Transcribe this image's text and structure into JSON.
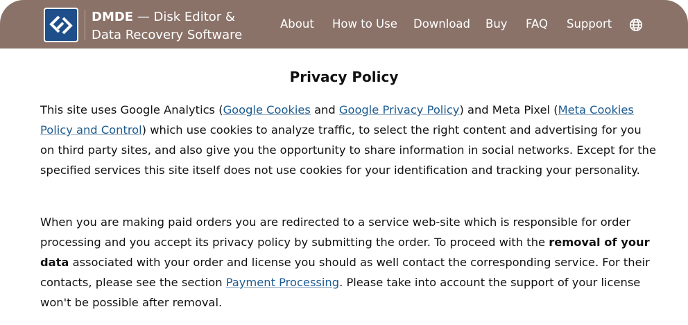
{
  "header": {
    "brand_name": "DMDE",
    "brand_line1_rest": " — Disk Editor &",
    "brand_line2": "Data Recovery Software",
    "nav": [
      "About",
      "How to Use",
      "Download",
      "Buy",
      "FAQ",
      "Support"
    ],
    "language_icon": "globe-icon",
    "logo_icon": "dmde-logo-icon",
    "colors": {
      "header_bg": "#8a7268",
      "logo_bg": "#1e4f8a",
      "link": "#1c5a8f"
    }
  },
  "page": {
    "title": "Privacy Policy",
    "p1": {
      "t1": "This site uses Google Analytics (",
      "link1": "Google Cookies",
      "t2": " and ",
      "link2": "Google Privacy Policy",
      "t3": ") and Meta Pixel (",
      "link3": "Meta Cookies Policy and Control",
      "t4": ") which use cookies to analyze traffic, to select the right content and advertising for you on third party sites, and also give you the opportunity to share information in social networks. Except for the specified services this site itself does not use cookies for your identification and tracking your personality."
    },
    "p2": {
      "t1": "When you are making paid orders you are redirected to a service web-site which is responsible for order processing and you accept its privacy policy by submitting the order. To proceed with the ",
      "bold": "removal of your data",
      "t2": " associated with your order and license you should as well contact the corresponding service. For their contacts, please see the section ",
      "link1": "Payment Processing",
      "t3": ". Please take into account the support of your license won't be possible after removal."
    }
  }
}
